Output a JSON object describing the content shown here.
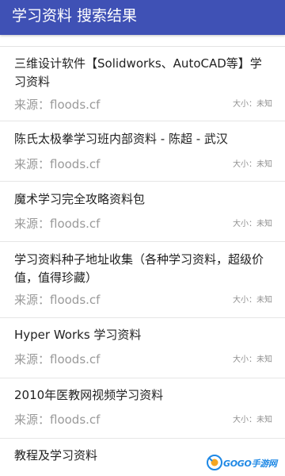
{
  "header": {
    "title": "学习资料 搜索结果",
    "background_color": "#3f51b5"
  },
  "results": [
    {
      "title": "三维设计软件【Solidworks、AutoCAD等】学习资料",
      "source": "来源：floods.cf",
      "size": "大小：未知"
    },
    {
      "title": "陈氏太极拳学习班内部资料 - 陈超 - 武汉",
      "source": "来源：floods.cf",
      "size": "大小：未知"
    },
    {
      "title": "魔术学习完全攻略资料包",
      "source": "来源：floods.cf",
      "size": "大小：未知"
    },
    {
      "title": "学习资料种子地址收集（各种学习资料，超级价值，值得珍藏）",
      "source": "来源：floods.cf",
      "size": "大小：未知"
    },
    {
      "title": "Hyper Works 学习资料",
      "source": "来源：floods.cf",
      "size": "大小：未知"
    },
    {
      "title": "2010年医教网视频学习资料",
      "source": "来源：floods.cf",
      "size": "大小：未知"
    },
    {
      "title": "教程及学习资料",
      "source": "",
      "size": ""
    }
  ],
  "watermark": {
    "text": "GOGO手游网",
    "icon": "gogo-logo-icon"
  }
}
